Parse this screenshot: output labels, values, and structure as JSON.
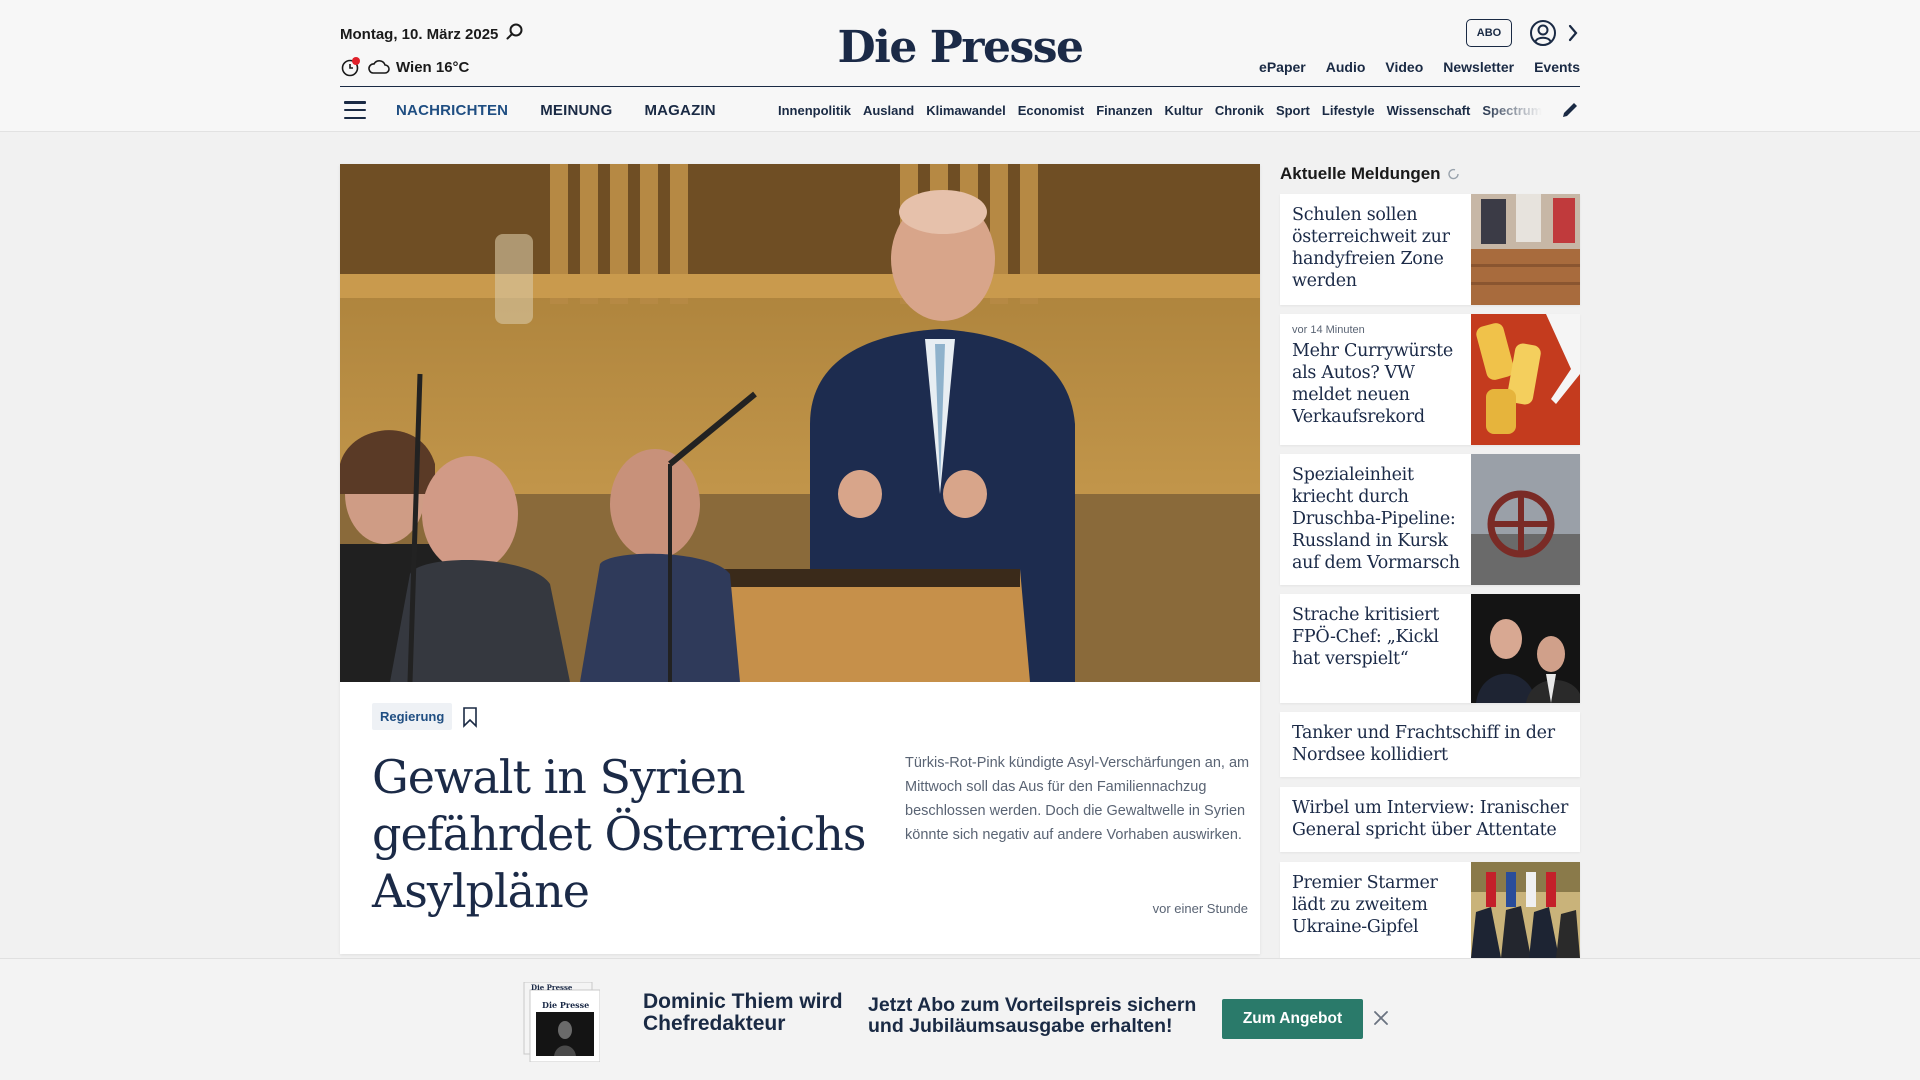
{
  "header": {
    "date": "Montag, 10. März 2025",
    "weather": "Wien 16°C",
    "logo": "Die Presse",
    "abo_label": "ABO",
    "top_links": [
      "ePaper",
      "Audio",
      "Video",
      "Newsletter",
      "Events"
    ],
    "main_nav": [
      "NACHRICHTEN",
      "MEINUNG",
      "MAGAZIN"
    ],
    "sub_nav": [
      "Innenpolitik",
      "Ausland",
      "Klimawandel",
      "Economist",
      "Finanzen",
      "Kultur",
      "Chronik",
      "Sport",
      "Lifestyle",
      "Wissenschaft",
      "Spectrum"
    ]
  },
  "lead": {
    "tag": "Regierung",
    "headline": "Gewalt in Syrien gefährdet Österreichs Asylpläne",
    "teaser": "Türkis-Rot-Pink kündigte Asyl-Verschärfungen an, am Mittwoch soll das Aus für den Familiennachzug beschlossen werden. Doch die Gewaltwelle in Syrien könnte sich negativ auf andere Vorhaben auswirken.",
    "time": "vor einer Stunde"
  },
  "sidebar": {
    "title": "Aktuelle Meldungen",
    "items": [
      {
        "title": "Schulen sollen österreichweit zur handyfreien Zone werden",
        "meta": ""
      },
      {
        "title": "Mehr Currywürste als Autos? VW meldet neuen Verkaufsrekord",
        "meta": "vor 14 Minuten"
      },
      {
        "title": "Spezialeinheit kriecht durch Druschba-Pipeline: Russland in Kursk auf dem Vormarsch",
        "meta": ""
      },
      {
        "title": "Strache kritisiert FPÖ-Chef: „Kickl hat verspielt“",
        "meta": ""
      },
      {
        "title": "Tanker und Frachtschiff in der Nordsee kollidiert",
        "meta": ""
      },
      {
        "title": "Wirbel um Interview: Iranischer General spricht über Attentate",
        "meta": ""
      },
      {
        "title": "Premier Starmer lädt zu zweitem Ukraine-Gipfel",
        "meta": ""
      }
    ]
  },
  "promo": {
    "headline": "Dominic Thiem wird Chefredakteur",
    "text": "Jetzt Abo zum Vorteilspreis sichern und Jubiläumsausgabe erhalten!",
    "button": "Zum Angebot",
    "mini_logo": "Die Presse"
  },
  "colors": {
    "navy": "#1b2a47",
    "accent_blue": "#1f4e82",
    "promo_button": "#2a7a6a",
    "notification_dot": "#e0202a"
  }
}
